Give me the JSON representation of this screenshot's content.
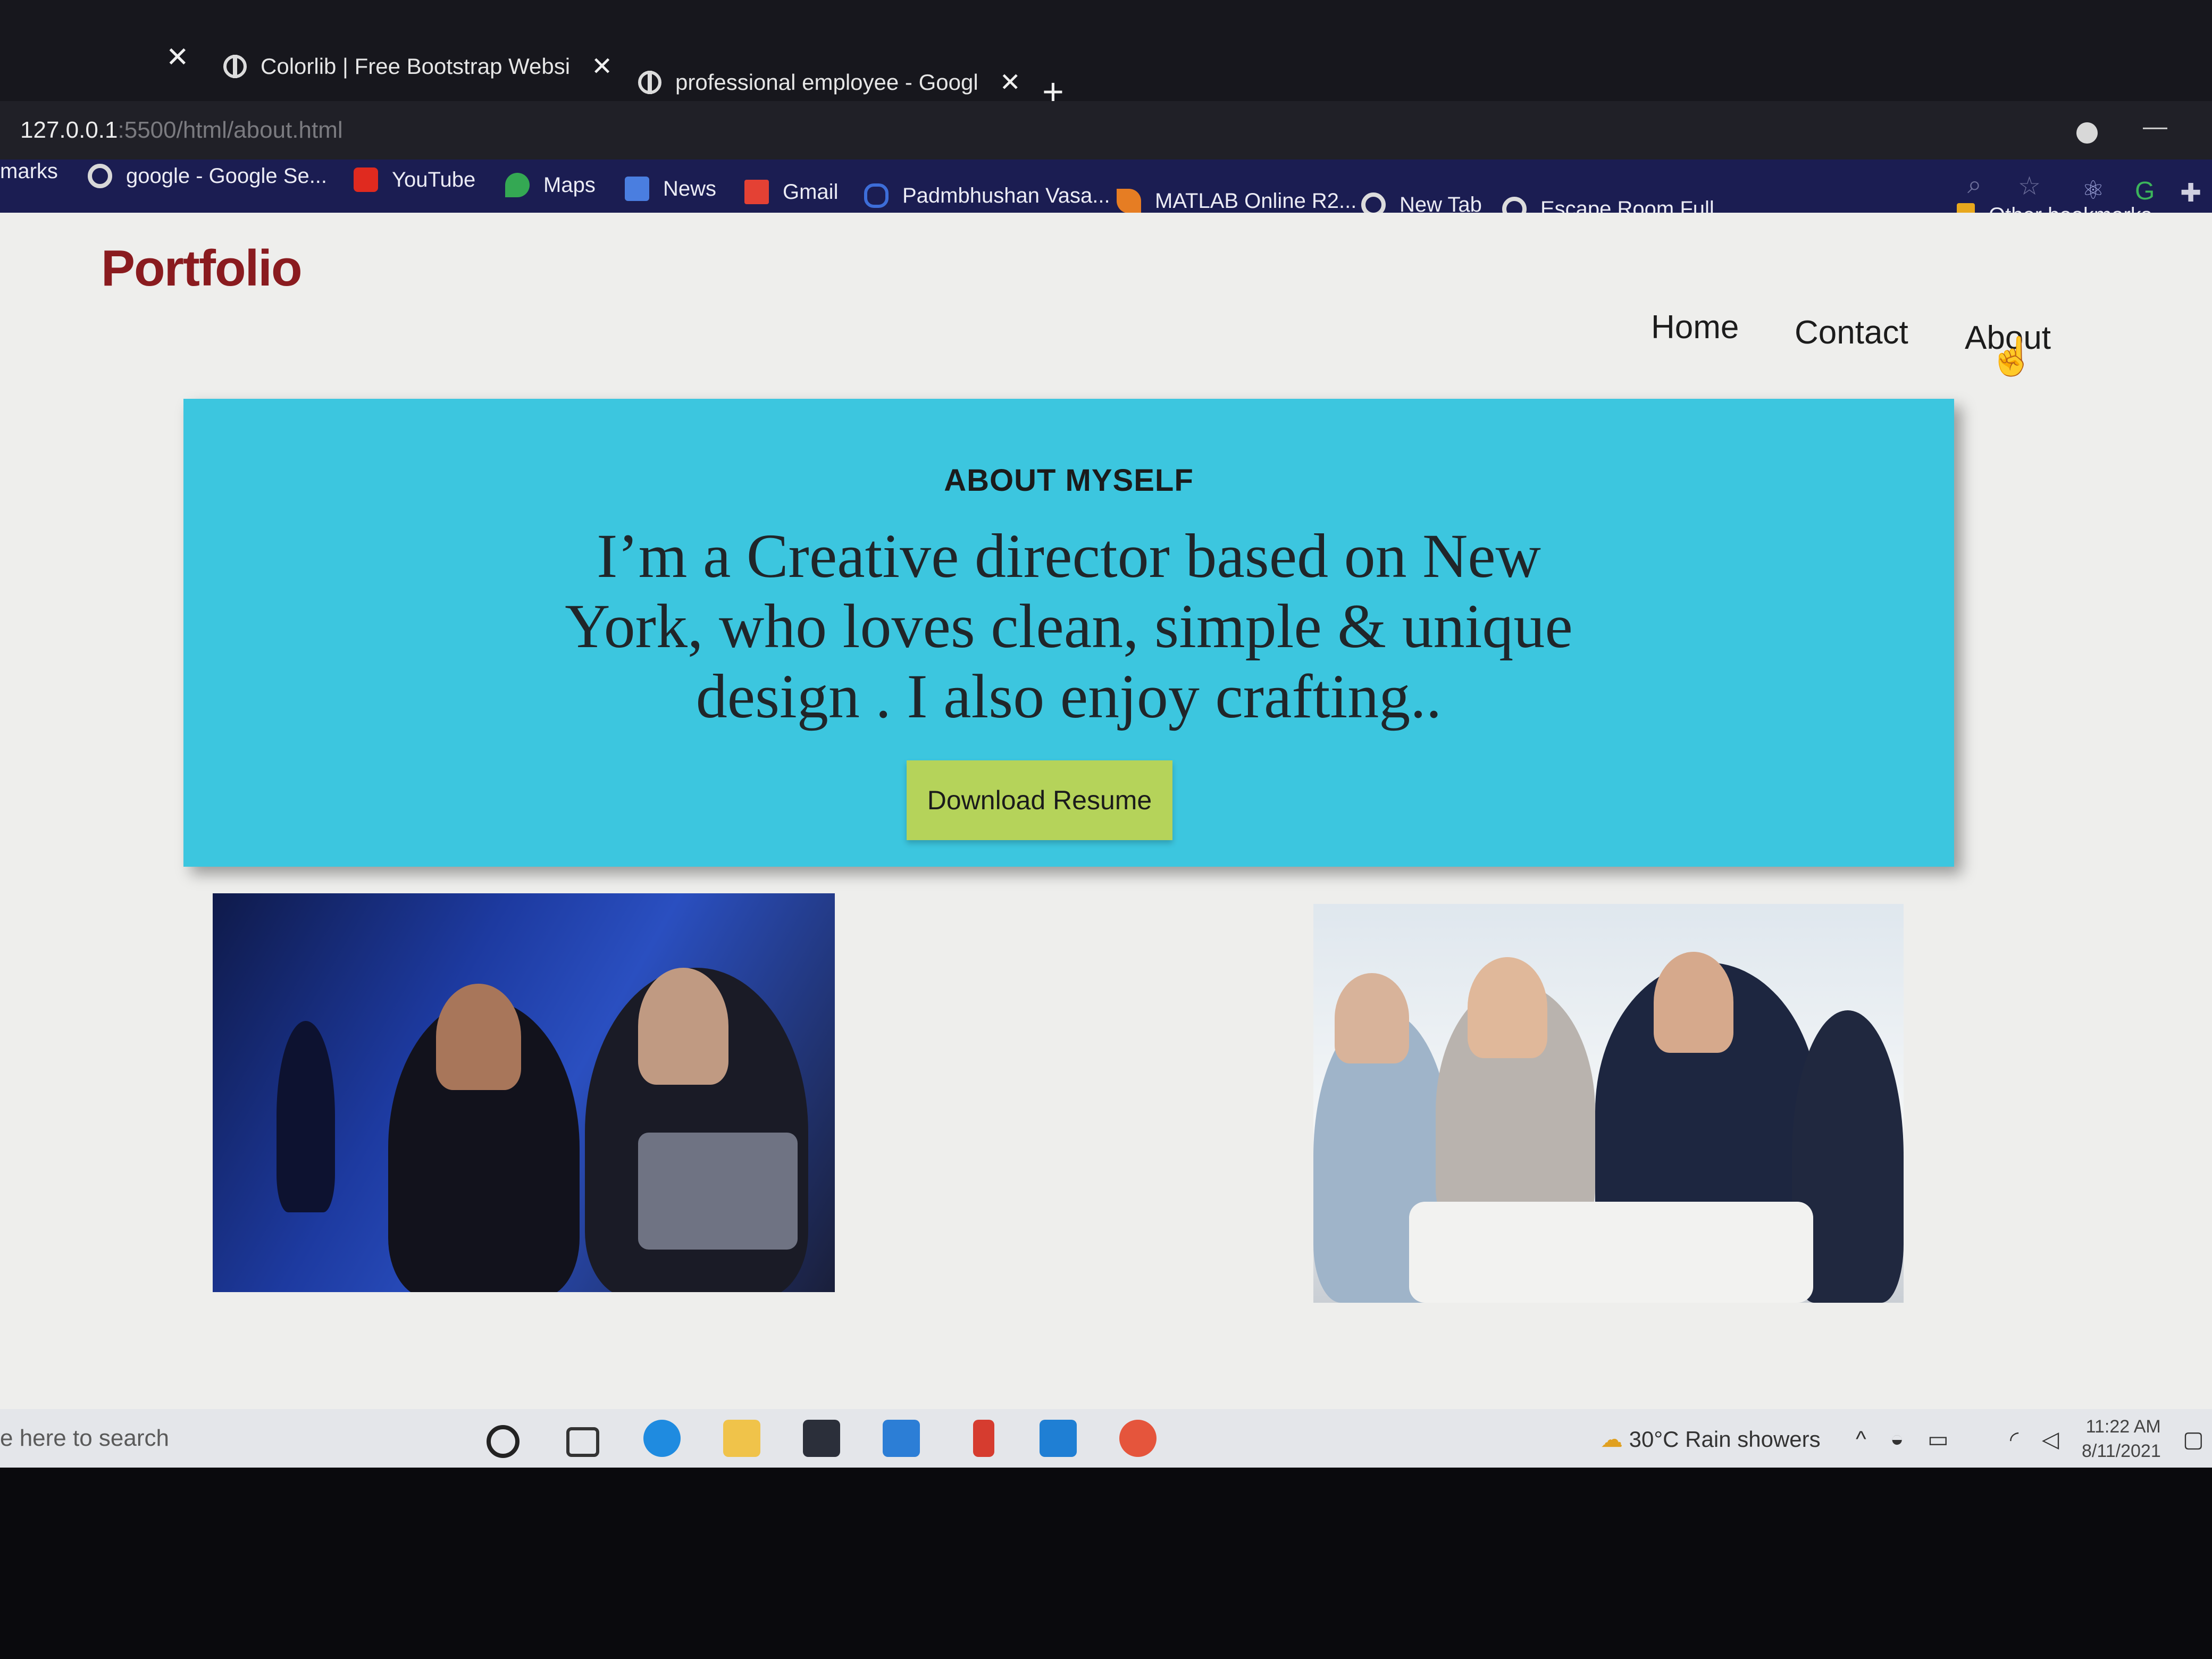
{
  "browser": {
    "tabs": [
      {
        "title": "Colorlib | Free Bootstrap Websi"
      },
      {
        "title": "professional employee - Googl"
      }
    ],
    "url_host": "127.0.0.1",
    "url_rest": ":5500/html/about.html",
    "bookmarks_prefix": "marks",
    "bookmarks": [
      {
        "label": "google - Google Se...",
        "icon": "google-icon",
        "color": "#4a88f0"
      },
      {
        "label": "YouTube",
        "icon": "youtube-icon",
        "color": "#e02a1f"
      },
      {
        "label": "Maps",
        "icon": "maps-icon",
        "color": "#34a853"
      },
      {
        "label": "News",
        "icon": "news-icon",
        "color": "#4a7ee0"
      },
      {
        "label": "Gmail",
        "icon": "gmail-icon",
        "color": "#e44134"
      },
      {
        "label": "Padmbhushan Vasa...",
        "icon": "link-icon",
        "color": "#3d6dd8"
      },
      {
        "label": "MATLAB Online R2...",
        "icon": "matlab-icon",
        "color": "#e67d23"
      },
      {
        "label": "New Tab",
        "icon": "globe-icon",
        "color": "#dcdcdc"
      },
      {
        "label": "Escape Room Full...",
        "icon": "globe-icon",
        "color": "#dcdcdc"
      }
    ],
    "other_bookmarks": "Other bookmarks"
  },
  "page": {
    "logo": "Portfolio",
    "nav": [
      "Home",
      "Contact",
      "About"
    ],
    "hero": {
      "heading": "ABOUT MYSELF",
      "text": "I’m a Creative director based on New York, who loves clean, simple & unique design . I also enjoy crafting..",
      "button": "Download Resume"
    },
    "colors": {
      "hero_bg": "#3cc6df",
      "button_bg": "#b5d35a",
      "logo": "#8a1b1f"
    }
  },
  "taskbar": {
    "search_placeholder": "e here to search",
    "weather": "30°C  Rain showers",
    "time": "11:22 AM",
    "date": "8/11/2021"
  }
}
